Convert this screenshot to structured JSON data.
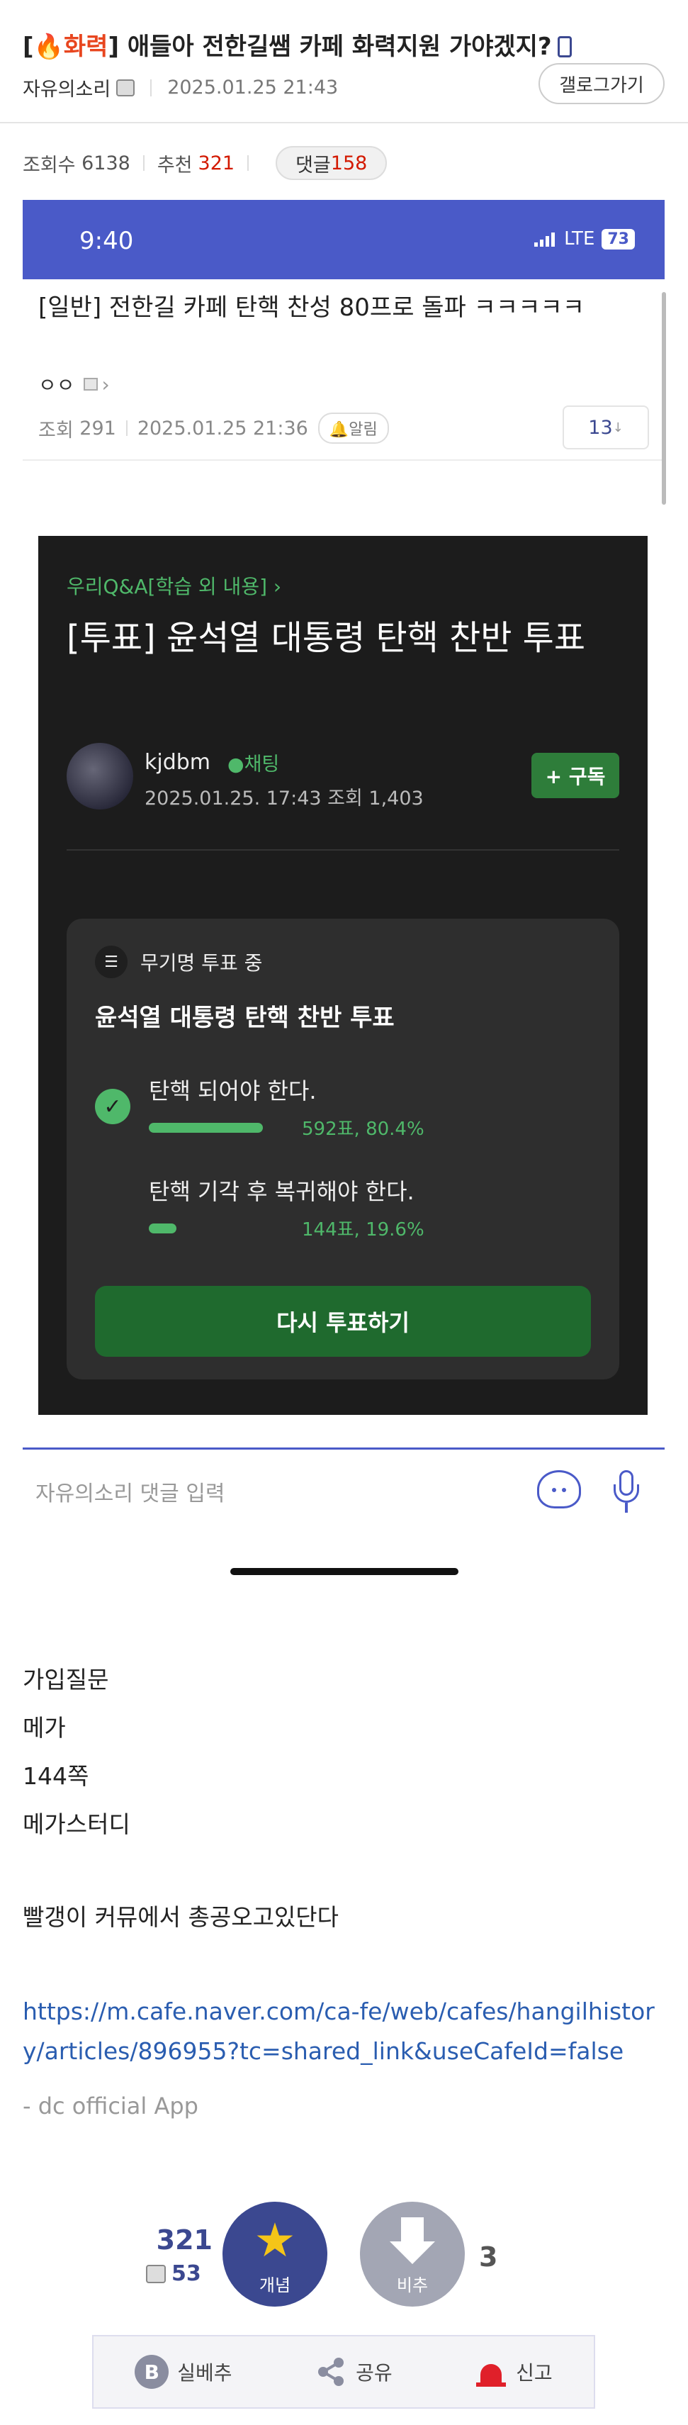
{
  "header": {
    "title_prefix": "[",
    "title_fire": "🔥화력",
    "title_rest": "] 애들아 전한길쌤 카페 화력지원 가야겠지?",
    "author": "자유의소리",
    "datetime": "2025.01.25 21:43",
    "gallery_button": "갤로그가기"
  },
  "stats": {
    "views_label": "조회수",
    "views": "6138",
    "recommend_label": "추천",
    "recommend": "321",
    "comments_label": "댓글",
    "comments": "158"
  },
  "screenshot": {
    "status_time": "9:40",
    "status_network": "LTE",
    "status_battery": "73",
    "post_title": "[일반] 전한길 카페 탄핵 찬성 80프로 돌파 ㅋㅋㅋㅋㅋ",
    "post_author": "ㅇㅇ",
    "post_views_label": "조회",
    "post_views": "291",
    "post_datetime": "2025.01.25 21:36",
    "alarm_label": "🔔알림",
    "comment_count": "13",
    "card": {
      "breadcrumb": "우리Q&A[학습 외 내용] ›",
      "title": "[투표] 윤석열 대통령 탄핵 찬반 투표",
      "username": "kjdbm",
      "chat_label": "채팅",
      "meta": "2025.01.25. 17:43  조회 1,403",
      "subscribe": "+ 구독",
      "poll_badge": "무기명 투표 중",
      "poll_question": "윤석열 대통령 탄핵 찬반 투표",
      "options": [
        {
          "text": "탄핵 되어야 한다.",
          "result": "592표, 80.4%",
          "fraction": 0.804
        },
        {
          "text": "탄핵 기각 후 복귀해야 한다.",
          "result": "144표, 19.6%",
          "fraction": 0.196
        }
      ],
      "revote": "다시 투표하기"
    },
    "comment_placeholder": "자유의소리 댓글 입력"
  },
  "body": {
    "lines": [
      "가입질문",
      "메가",
      "144쪽",
      "메가스터디"
    ],
    "line2": "빨갱이 커뮤에서 총공오고있단다",
    "link": "https://m.cafe.naver.com/ca-fe/web/cafes/hangilhistory/articles/896955?tc=shared_link&useCafeId=false",
    "signature": "- dc official App"
  },
  "recommend": {
    "up_count": "321",
    "fixed_count": "53",
    "up_label": "개념",
    "down_label": "비추",
    "down_count": "3"
  },
  "bottom_bar": {
    "b_label": "실베추",
    "share_label": "공유",
    "report_label": "신고"
  },
  "colors": {
    "accent": "#3b4890",
    "recommend_red": "#d31900",
    "poll_green": "#4fb86a"
  }
}
